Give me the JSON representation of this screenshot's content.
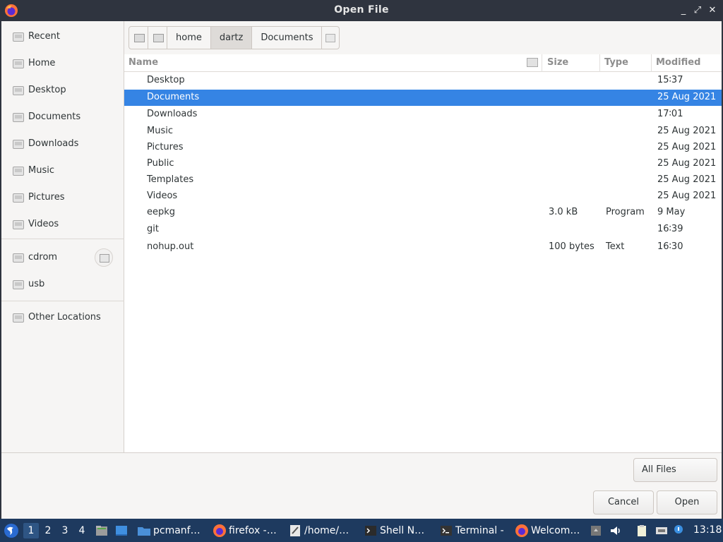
{
  "window": {
    "title": "Open File",
    "controls": {
      "minimize": "_",
      "maximize": "⤢",
      "close": "✕"
    }
  },
  "sidebar": {
    "places": [
      {
        "label": "Recent",
        "icon": "recent-icon"
      },
      {
        "label": "Home",
        "icon": "home-icon"
      },
      {
        "label": "Desktop",
        "icon": "desktop-icon"
      },
      {
        "label": "Documents",
        "icon": "documents-icon"
      },
      {
        "label": "Downloads",
        "icon": "downloads-icon"
      },
      {
        "label": "Music",
        "icon": "music-icon"
      },
      {
        "label": "Pictures",
        "icon": "pictures-icon"
      },
      {
        "label": "Videos",
        "icon": "videos-icon"
      }
    ],
    "devices": [
      {
        "label": "cdrom",
        "icon": "drive-icon",
        "eject": true
      },
      {
        "label": "usb",
        "icon": "drive-icon",
        "eject": false
      }
    ],
    "other": {
      "label": "Other Locations",
      "icon": "network-icon"
    }
  },
  "pathbar": {
    "segments": [
      "home",
      "dartz",
      "Documents"
    ],
    "active_index": 1
  },
  "filelist": {
    "columns": {
      "name": "Name",
      "size": "Size",
      "type": "Type",
      "modified": "Modified"
    },
    "rows": [
      {
        "name": "Desktop",
        "size": "",
        "type": "",
        "modified": "15∶37",
        "selected": false
      },
      {
        "name": "Documents",
        "size": "",
        "type": "",
        "modified": "25 Aug 2021",
        "selected": true
      },
      {
        "name": "Downloads",
        "size": "",
        "type": "",
        "modified": "17∶01",
        "selected": false
      },
      {
        "name": "Music",
        "size": "",
        "type": "",
        "modified": "25 Aug 2021",
        "selected": false
      },
      {
        "name": "Pictures",
        "size": "",
        "type": "",
        "modified": "25 Aug 2021",
        "selected": false
      },
      {
        "name": "Public",
        "size": "",
        "type": "",
        "modified": "25 Aug 2021",
        "selected": false
      },
      {
        "name": "Templates",
        "size": "",
        "type": "",
        "modified": "25 Aug 2021",
        "selected": false
      },
      {
        "name": "Videos",
        "size": "",
        "type": "",
        "modified": "25 Aug 2021",
        "selected": false
      },
      {
        "name": "eepkg",
        "size": "3.0 kB",
        "type": "Program",
        "modified": "9 May",
        "selected": false
      },
      {
        "name": "git",
        "size": "",
        "type": "",
        "modified": "16∶39",
        "selected": false
      },
      {
        "name": "nohup.out",
        "size": "100 bytes",
        "type": "Text",
        "modified": "16∶30",
        "selected": false
      }
    ]
  },
  "footer": {
    "filter_label": "All Files",
    "cancel_label": "Cancel",
    "open_label": "Open"
  },
  "taskbar": {
    "workspaces": [
      "1",
      "2",
      "3",
      "4"
    ],
    "active_workspace": 0,
    "tasks": [
      {
        "label": "pcmanf…",
        "icon": "folder-icon"
      },
      {
        "label": "firefox -…",
        "icon": "firefox-icon"
      },
      {
        "label": "/home/…",
        "icon": "text-editor-icon"
      },
      {
        "label": "Shell N…",
        "icon": "shell-icon"
      },
      {
        "label": "Terminal -",
        "icon": "terminal-icon"
      },
      {
        "label": "Welcom…",
        "icon": "firefox-icon"
      }
    ],
    "clock": "13:18",
    "colors": {
      "panel": "#1e3a5f",
      "selection": "#3584e4"
    }
  }
}
